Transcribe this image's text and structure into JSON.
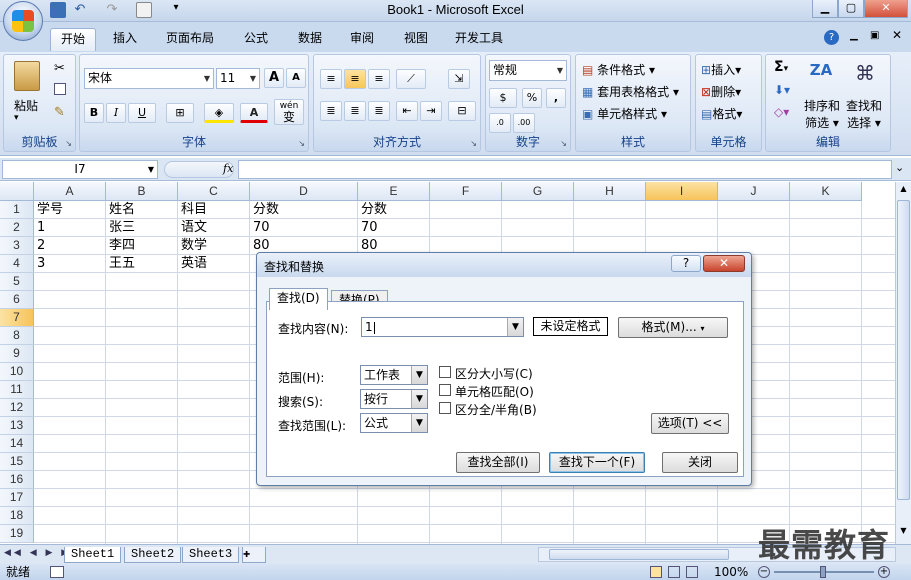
{
  "window": {
    "title": "Book1 - Microsoft Excel"
  },
  "tabs": [
    "开始",
    "插入",
    "页面布局",
    "公式",
    "数据",
    "审阅",
    "视图",
    "开发工具"
  ],
  "ribbon": {
    "clipboard": {
      "label": "剪贴板",
      "paste": "粘贴"
    },
    "font": {
      "label": "字体",
      "font_name": "宋体",
      "font_size": "11",
      "bold": "B",
      "italic": "I",
      "underline": "U",
      "grow": "A",
      "shrink": "A",
      "text_color": "A",
      "wen": "wén",
      "wen2": "变"
    },
    "alignment": {
      "label": "对齐方式"
    },
    "number": {
      "label": "数字",
      "format": "常规",
      "percent": "%",
      "comma": ","
    },
    "styles": {
      "label": "样式",
      "conditional": "条件格式",
      "table": "套用表格格式",
      "cell_styles": "单元格样式"
    },
    "cells": {
      "label": "单元格",
      "insert": "插入",
      "delete": "删除",
      "format": "格式"
    },
    "editing": {
      "label": "编辑",
      "sum": "Σ",
      "sort_l1": "排序和",
      "sort_l2": "筛选",
      "find_l1": "查找和",
      "find_l2": "选择"
    }
  },
  "formula_bar": {
    "name_box": "I7",
    "fx": "fx",
    "value": ""
  },
  "columns": [
    "A",
    "B",
    "C",
    "D",
    "E",
    "F",
    "G",
    "H",
    "I",
    "J",
    "K"
  ],
  "selected_col": "I",
  "selected_row": "7",
  "rows": [
    "1",
    "2",
    "3",
    "4",
    "5",
    "6",
    "7",
    "8",
    "9",
    "10",
    "11",
    "12",
    "13",
    "14",
    "15",
    "16",
    "17",
    "18",
    "19"
  ],
  "cells": {
    "r1": [
      "学号",
      "姓名",
      "科目",
      "分数",
      "分数"
    ],
    "r2": [
      "1",
      "张三",
      "语文",
      "70",
      "70"
    ],
    "r3": [
      "2",
      "李四",
      "数学",
      "80",
      "80"
    ],
    "r4": [
      "3",
      "王五",
      "英语"
    ]
  },
  "sheets": [
    "Sheet1",
    "Sheet2",
    "Sheet3"
  ],
  "status": {
    "ready": "就绪",
    "zoom": "100%"
  },
  "dialog": {
    "title": "查找和替换",
    "help": "?",
    "tab_find": "查找(D)",
    "tab_replace": "替换(P)",
    "find_label": "查找内容(N):",
    "find_value": "1",
    "format_status": "未设定格式",
    "format_button": "格式(M)...",
    "scope_label": "范围(H):",
    "scope_value": "工作表",
    "search_label": "搜索(S):",
    "search_value": "按行",
    "lookin_label": "查找范围(L):",
    "lookin_value": "公式",
    "match_case": "区分大小写(C)",
    "match_cell": "单元格匹配(O)",
    "match_width": "区分全/半角(B)",
    "options_button": "选项(T) <<",
    "find_all": "查找全部(I)",
    "find_next": "查找下一个(F)",
    "close": "关闭"
  },
  "watermark": "最需教育"
}
